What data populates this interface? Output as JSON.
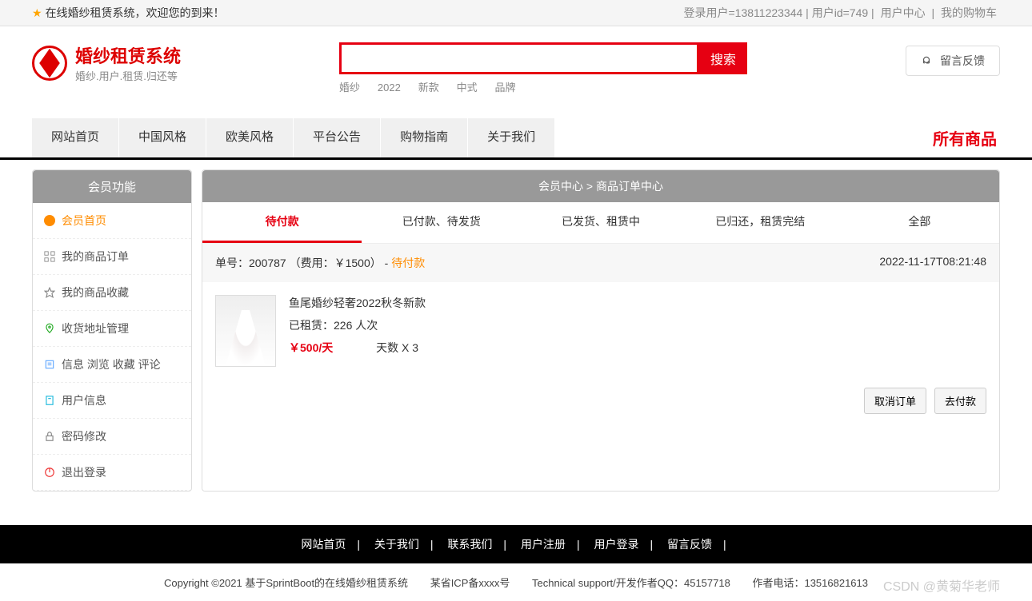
{
  "topbar": {
    "welcome": "在线婚纱租赁系统，欢迎您的到来！",
    "login_user_label": "登录用户=13811223344",
    "user_id_label": "用户id=749",
    "user_center": "用户中心",
    "my_cart": "我的购物车"
  },
  "logo": {
    "title": "婚纱租赁系统",
    "subtitle": "婚纱.用户.租赁.归还等"
  },
  "search": {
    "button": "搜索",
    "tags": [
      "婚纱",
      "2022",
      "新款",
      "中式",
      "品牌"
    ]
  },
  "feedback": {
    "label": "留言反馈"
  },
  "nav": {
    "items": [
      "网站首页",
      "中国风格",
      "欧美风格",
      "平台公告",
      "购物指南",
      "关于我们"
    ],
    "all_products": "所有商品"
  },
  "sidebar": {
    "header": "会员功能",
    "items": [
      {
        "label": "会员首页",
        "color": "#ff8c00"
      },
      {
        "label": "我的商品订单",
        "color": "#888"
      },
      {
        "label": "我的商品收藏",
        "color": "#888"
      },
      {
        "label": "收货地址管理",
        "color": "#2a2"
      },
      {
        "label": "信息 浏览 收藏 评论",
        "color": "#6af"
      },
      {
        "label": "用户信息",
        "color": "#2bd"
      },
      {
        "label": "密码修改",
        "color": "#888"
      },
      {
        "label": "退出登录",
        "color": "#e33"
      }
    ]
  },
  "main": {
    "breadcrumb": "会员中心 > 商品订单中心",
    "tabs": [
      "待付款",
      "已付款、待发货",
      "已发货、租赁中",
      "已归还，租赁完结",
      "全部"
    ],
    "order": {
      "no_label": "单号：200787 （费用：￥1500） - ",
      "status": "待付款",
      "time": "2022-11-17T08:21:48",
      "product_name": "鱼尾婚纱轻奢2022秋冬新款",
      "rent_count": "已租赁：226 人次",
      "price": "￥500/天",
      "days": "天数 X 3",
      "cancel": "取消订单",
      "pay": "去付款"
    }
  },
  "footer": {
    "links": [
      "网站首页",
      "关于我们",
      "联系我们",
      "用户注册",
      "用户登录",
      "留言反馈"
    ],
    "copyright": "Copyright ©2021 基于SprintBoot的在线婚纱租赁系统",
    "icp": "某省ICP备xxxx号",
    "support": "Technical support/开发作者QQ：45157718",
    "phone": "作者电话：13516821613",
    "watermark": "CSDN @黄菊华老师"
  }
}
